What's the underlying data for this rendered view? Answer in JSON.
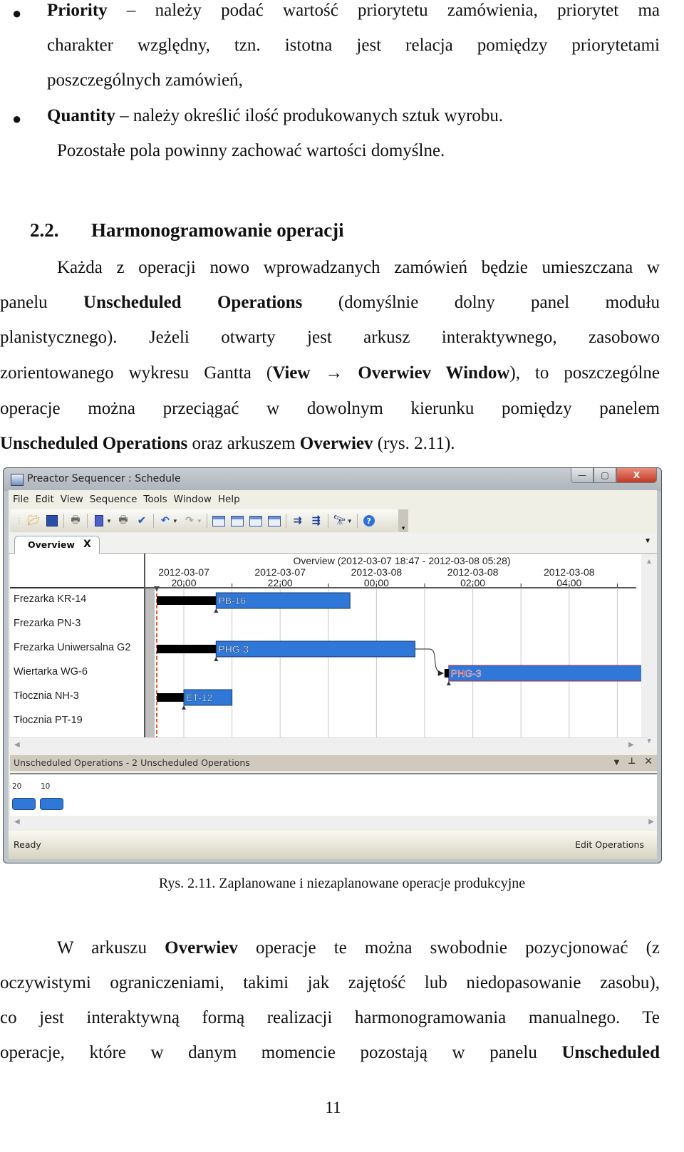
{
  "document": {
    "bullets": [
      {
        "term": "Priority",
        "lines": [
          " – należy podać wartość priorytetu zamówienia, priorytet ma",
          "charakter względny, tzn. istotna jest relacja pomiędzy priorytetami",
          "poszczególnych zamówień,"
        ]
      },
      {
        "term": "Quantity",
        "lines": [
          " – należy określić ilość produkowanych sztuk wyrobu."
        ]
      }
    ],
    "after_bullets": "Pozostałe pola powinny zachować wartości domyślne.",
    "section": {
      "number": "2.2.",
      "title": "Harmonogramowanie operacji"
    },
    "para1": {
      "l1": "Każda z operacji nowo wprowadzanych zamówień będzie umieszczana w",
      "l2_a": "panelu",
      "l2_b": "Unscheduled",
      "l2_c": "Operations",
      "l2_d": "(domyślnie",
      "l2_e": "dolny",
      "l2_f": "panel",
      "l2_g": "modułu",
      "l3": "planistycznego). Jeżeli otwarty jest arkusz interaktywnego, zasobowo",
      "l4_a": "zorientowanego wykresu Gantta (",
      "l4_b": "View → Overwiev Window",
      "l4_c": "), to poszczególne",
      "l5": "operacje można przeciągać w dowolnym kierunku pomiędzy panelem",
      "l6_a": "Unscheduled Operations",
      "l6_b": " oraz arkuszem ",
      "l6_c": "Overwiev",
      "l6_d": " (rys. 2.11)."
    },
    "caption": "Rys. 2.11. Zaplanowane i niezaplanowane operacje produkcyjne",
    "para2": {
      "l1_a": "W arkuszu ",
      "l1_b": "Overwiev",
      "l1_c": " operacje te można swobodnie pozycjonować (z",
      "l2": "oczywistymi ograniczeniami, takimi jak zajętość lub niedopasowanie zasobu),",
      "l3": "co jest interaktywną formą realizacji harmonogramowania manualnego. Te",
      "l4_a": "operacje, które w danym momencie pozostają w panelu ",
      "l4_b": "Unscheduled"
    },
    "page_number": "11"
  },
  "app": {
    "title": "Preactor Sequencer : Schedule",
    "window_buttons": {
      "minimize": "—",
      "maximize": "▢",
      "close": "X"
    },
    "menu": [
      "File",
      "Edit",
      "View",
      "Sequence",
      "Tools",
      "Window",
      "Help"
    ],
    "toolbar_icons": [
      "open-folder",
      "save",
      "print",
      "document",
      "print-preview",
      "check",
      "undo",
      "redo",
      "gantt-view",
      "table-view",
      "chart-view",
      "plan-view",
      "sequence-forward",
      "sequence-backward",
      "find",
      "help"
    ],
    "tab": {
      "label": "Overview",
      "close": "X"
    },
    "gantt": {
      "header_title": "Overview    (2012-03-07 18:47 - 2012-03-08 05:28)",
      "time_ticks": [
        {
          "date": "2012-03-07",
          "time": "20:00"
        },
        {
          "date": "2012-03-07",
          "time": "22:00"
        },
        {
          "date": "2012-03-08",
          "time": "00:00"
        },
        {
          "date": "2012-03-08",
          "time": "02:00"
        },
        {
          "date": "2012-03-08",
          "time": "04:00"
        }
      ],
      "resources": [
        "Frezarka KR-14",
        "Frezarka PN-3",
        "Frezarka Uniwersalna G2",
        "Wiertarka WG-6",
        "Tłocznia NH-3",
        "Tłocznia PT-19"
      ],
      "range_start_hours": 18.78,
      "range_end_hours": 29.47,
      "operations": [
        {
          "label": "PB-16",
          "resource": 0,
          "start_h": 20.67,
          "end_h": 23.45,
          "setup_start_h": 19.0,
          "color": "#2f78d8",
          "label_color": "#ffffff",
          "highlight": false
        },
        {
          "label": "PHG-3",
          "resource": 2,
          "start_h": 20.67,
          "end_h": 24.8,
          "setup_start_h": 19.0,
          "color": "#2f78d8",
          "label_color": "#ffffff",
          "highlight": false
        },
        {
          "label": "PHG-3",
          "resource": 3,
          "start_h": 25.5,
          "end_h": 29.75,
          "setup_start_h": null,
          "color": "#2f78d8",
          "label_color": "#e83030",
          "highlight": true
        },
        {
          "label": "ET-12",
          "resource": 4,
          "start_h": 20.0,
          "end_h": 21.0,
          "setup_start_h": 19.0,
          "color": "#2f78d8",
          "label_color": "#ffffff",
          "highlight": false
        }
      ]
    },
    "unscheduled": {
      "header": "Unscheduled Operations - 2 Unscheduled Operations",
      "items": [
        {
          "label": "20"
        },
        {
          "label": "10"
        }
      ]
    },
    "status": {
      "left": "Ready",
      "right": "Edit Operations"
    }
  }
}
